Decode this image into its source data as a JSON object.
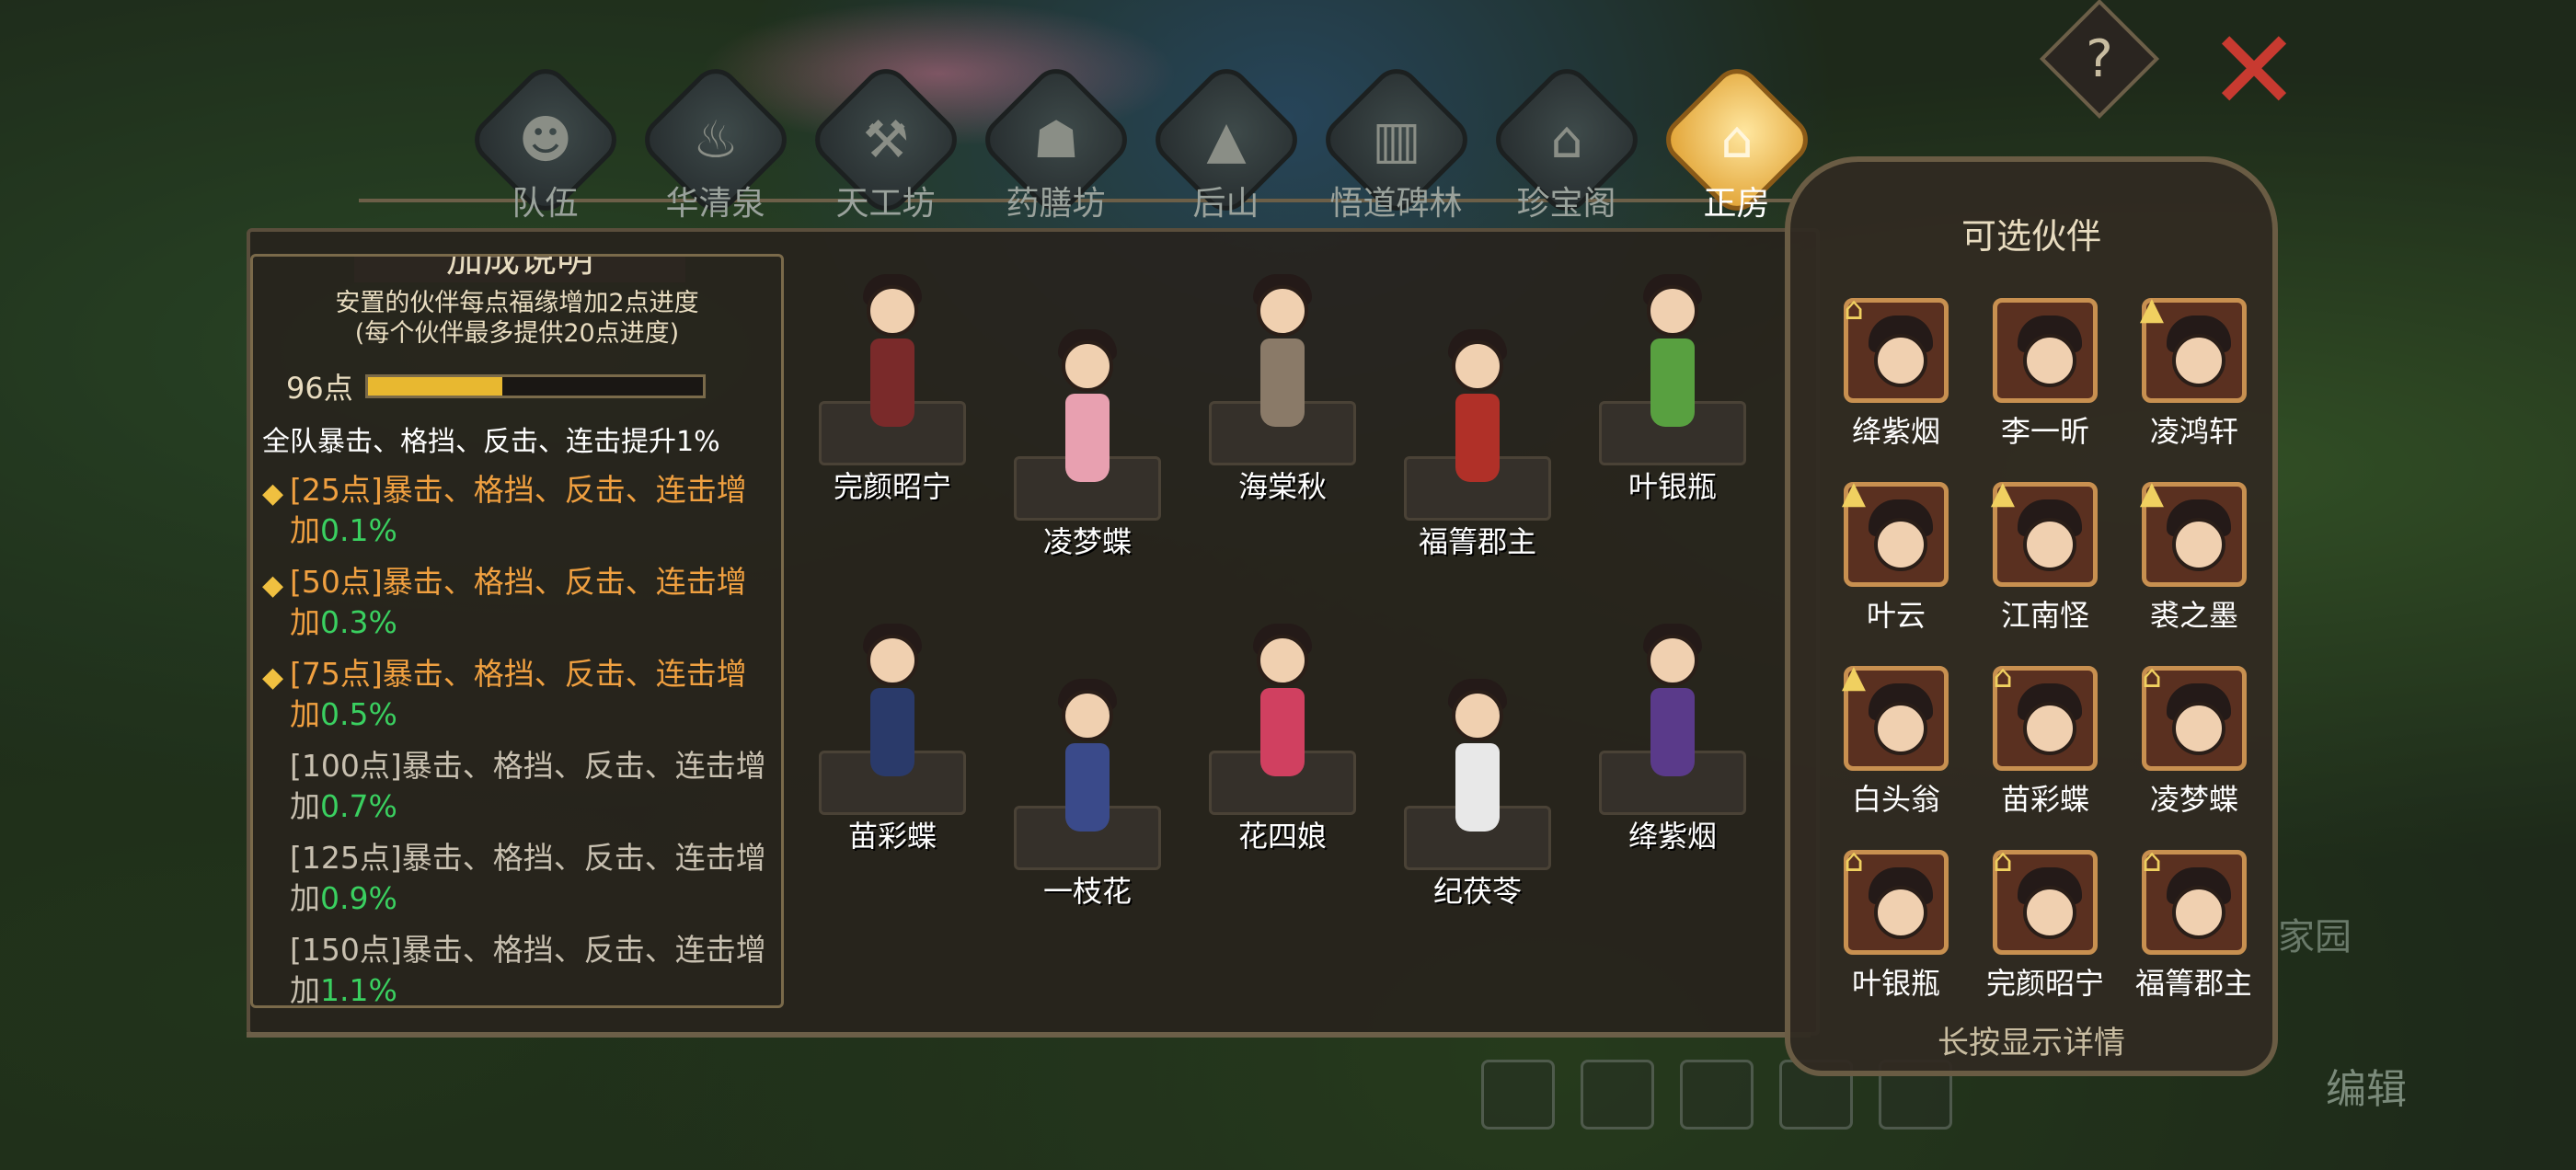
{
  "tabs": [
    {
      "label": "队伍",
      "icon": "team-icon",
      "glyph": "☻",
      "active": false
    },
    {
      "label": "华清泉",
      "icon": "spring-icon",
      "glyph": "♨",
      "active": false
    },
    {
      "label": "天工坊",
      "icon": "workshop-icon",
      "glyph": "⚒",
      "active": false
    },
    {
      "label": "药膳坊",
      "icon": "medicine-icon",
      "glyph": "☗",
      "active": false
    },
    {
      "label": "后山",
      "icon": "mountain-icon",
      "glyph": "▲",
      "active": false
    },
    {
      "label": "悟道碑林",
      "icon": "stele-icon",
      "glyph": "▥",
      "active": false
    },
    {
      "label": "珍宝阁",
      "icon": "treasure-pavilion-icon",
      "glyph": "⌂",
      "active": false
    },
    {
      "label": "正房",
      "icon": "main-house-icon",
      "glyph": "⌂",
      "active": true
    }
  ],
  "help_label": "?",
  "close_label": "✕",
  "bonus_panel": {
    "title": "加成说明",
    "desc_line1": "安置的伙伴每点福缘增加2点进度",
    "desc_line2": "(每个伙伴最多提供20点进度)",
    "points": "96点",
    "progress_fraction": 0.4,
    "team_bonus": "全队暴击、格挡、反击、连击提升1%",
    "tiers": [
      {
        "text": "[25点]暴击、格挡、反击、连击增加",
        "value": "0.1%",
        "unlocked": true
      },
      {
        "text": "[50点]暴击、格挡、反击、连击增加",
        "value": "0.3%",
        "unlocked": true
      },
      {
        "text": "[75点]暴击、格挡、反击、连击增加",
        "value": "0.5%",
        "unlocked": true
      },
      {
        "text": "[100点]暴击、格挡、反击、连击增加",
        "value": "0.7%",
        "unlocked": false
      },
      {
        "text": "[125点]暴击、格挡、反击、连击增加",
        "value": "0.9%",
        "unlocked": false
      },
      {
        "text": "[150点]暴击、格挡、反击、连击增加",
        "value": "1.1%",
        "unlocked": false
      }
    ]
  },
  "placed_characters": [
    {
      "name": "完颜昭宁",
      "outfit": "#7a2a2a"
    },
    {
      "name": "凌梦蝶",
      "outfit": "#e8a0b0"
    },
    {
      "name": "海棠秋",
      "outfit": "#8a7a68"
    },
    {
      "name": "福箐郡主",
      "outfit": "#b03028"
    },
    {
      "name": "叶银瓶",
      "outfit": "#58a040"
    },
    {
      "name": "苗彩蝶",
      "outfit": "#2a3a6a"
    },
    {
      "name": "一枝花",
      "outfit": "#3a4a8a"
    },
    {
      "name": "花四娘",
      "outfit": "#d04060"
    },
    {
      "name": "纪茯苓",
      "outfit": "#e8e8e8"
    },
    {
      "name": "绛紫烟",
      "outfit": "#5a3a8a"
    }
  ],
  "companion_panel": {
    "title": "可选伙伴",
    "hint": "长按显示详情",
    "companions": [
      {
        "name": "绛紫烟",
        "badge": "house-badge-icon",
        "badge_glyph": "⌂"
      },
      {
        "name": "李一昕",
        "badge": "",
        "badge_glyph": ""
      },
      {
        "name": "凌鸿轩",
        "badge": "mountain-badge-icon",
        "badge_glyph": "▲"
      },
      {
        "name": "叶云",
        "badge": "mountain-badge-icon",
        "badge_glyph": "▲"
      },
      {
        "name": "江南怪",
        "badge": "mountain-badge-icon",
        "badge_glyph": "▲"
      },
      {
        "name": "裘之墨",
        "badge": "mountain-badge-icon",
        "badge_glyph": "▲"
      },
      {
        "name": "白头翁",
        "badge": "mountain-badge-icon",
        "badge_glyph": "▲"
      },
      {
        "name": "苗彩蝶",
        "badge": "house-badge-icon",
        "badge_glyph": "⌂"
      },
      {
        "name": "凌梦蝶",
        "badge": "house-badge-icon",
        "badge_glyph": "⌂"
      },
      {
        "name": "叶银瓶",
        "badge": "house-badge-icon",
        "badge_glyph": "⌂"
      },
      {
        "name": "完颜昭宁",
        "badge": "house-badge-icon",
        "badge_glyph": "⌂"
      },
      {
        "name": "福箐郡主",
        "badge": "house-badge-icon",
        "badge_glyph": "⌂"
      }
    ]
  },
  "background": {
    "home_label": "家园",
    "edit_label": "编辑"
  },
  "colors": {
    "accent_gold": "#e8b830",
    "unlocked_orange": "#f0a040",
    "value_green": "#3ad060",
    "close_red": "#c83a30"
  }
}
